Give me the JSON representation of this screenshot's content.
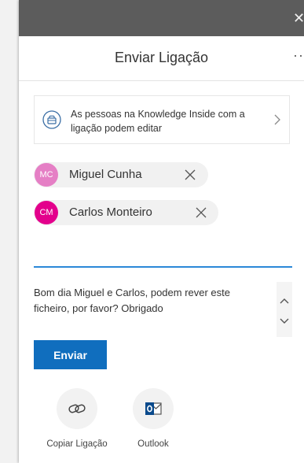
{
  "window": {
    "close_icon": "close-icon"
  },
  "header": {
    "title": "Enviar Ligação",
    "more_icon": "more-options-icon",
    "more_glyph": "···"
  },
  "permission": {
    "icon": "people-icon",
    "text": "As pessoas na Knowledge Inside com a ligação podem editar",
    "chevron_icon": "chevron-right-icon"
  },
  "recipients": [
    {
      "initials": "MC",
      "name": "Miguel Cunha",
      "avatar_color": "#e57fc5",
      "remove_icon": "close-icon"
    },
    {
      "initials": "CM",
      "name": "Carlos Monteiro",
      "avatar_color": "#e3008c",
      "remove_icon": "close-icon"
    }
  ],
  "recipient_input": {
    "value": "",
    "accent_color": "#2b88d8"
  },
  "message": {
    "text": "Bom dia Miguel e Carlos, podem rever este ficheiro, por favor? Obrigado"
  },
  "actions": {
    "send_label": "Enviar",
    "send_color": "#106ebe"
  },
  "share_options": [
    {
      "label": "Copiar Ligação",
      "icon": "link-icon"
    },
    {
      "label": "Outlook",
      "icon": "outlook-icon"
    }
  ]
}
